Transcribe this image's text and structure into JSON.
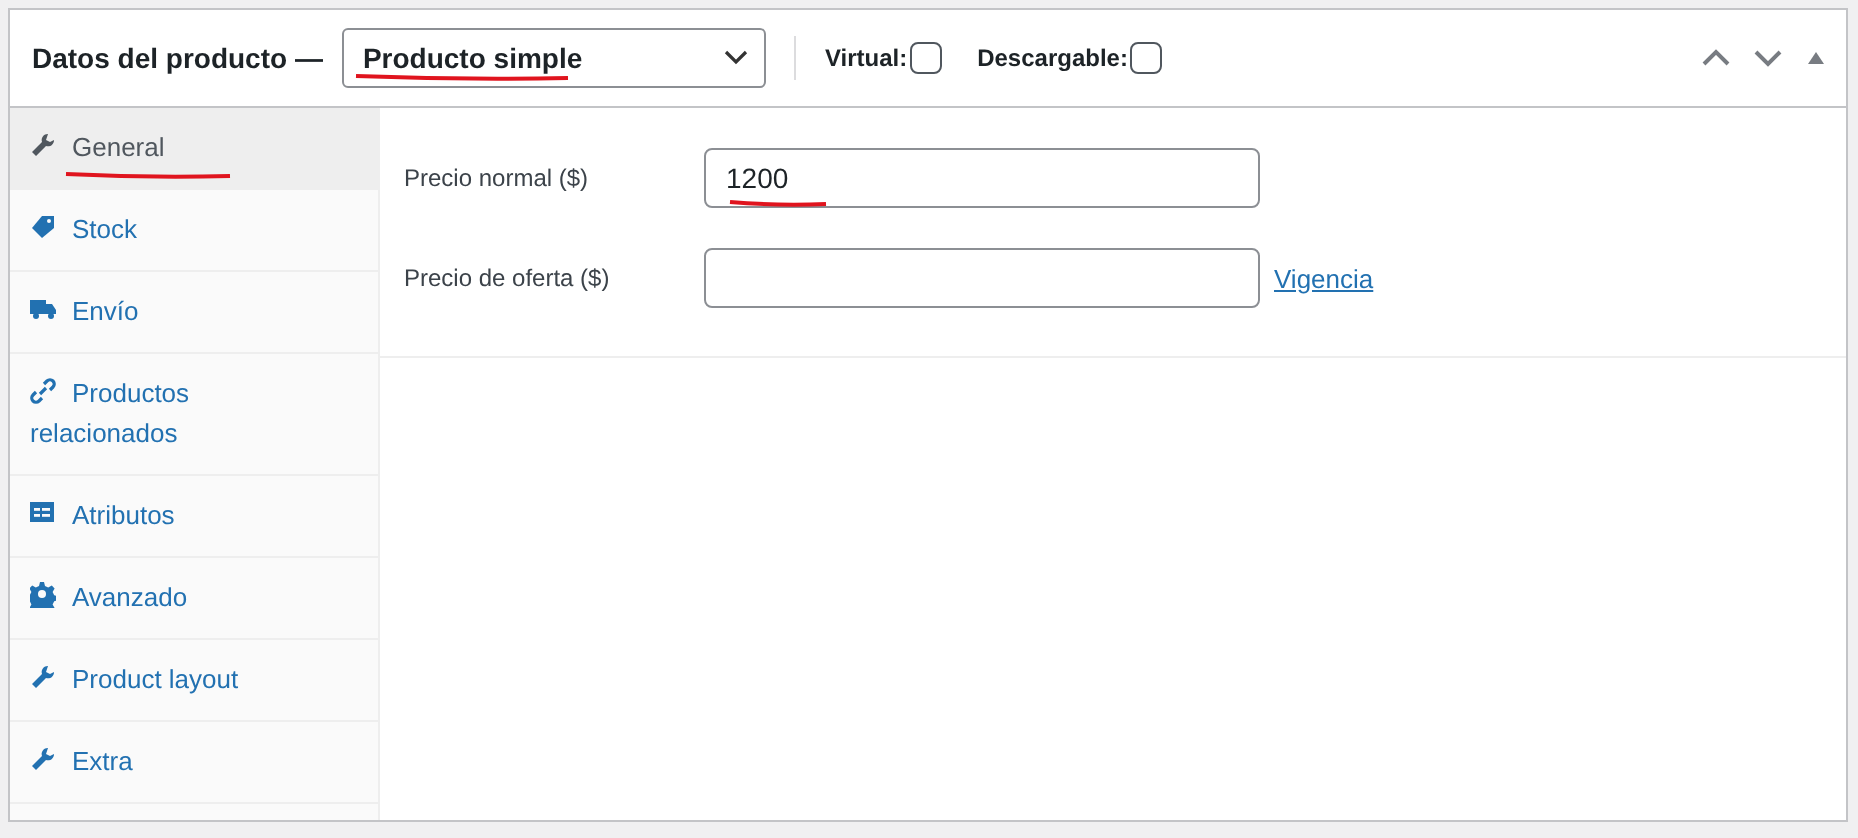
{
  "header": {
    "title": "Datos del producto —",
    "product_type": {
      "value": "Producto simple",
      "underlined": true
    },
    "options": [
      {
        "label": "Virtual:",
        "checked": false
      },
      {
        "label": "Descargable:",
        "checked": false
      }
    ]
  },
  "tabs": [
    {
      "label": "General",
      "kind": "wrench",
      "selected": true,
      "underlined": true
    },
    {
      "label": "Stock",
      "kind": "tag",
      "selected": false,
      "underlined": false
    },
    {
      "label": "Envío",
      "kind": "truck",
      "selected": false,
      "underlined": false
    },
    {
      "label": "Productos relacionados",
      "kind": "link",
      "selected": false,
      "underlined": false
    },
    {
      "label": "Atributos",
      "kind": "list",
      "selected": false,
      "underlined": false
    },
    {
      "label": "Avanzado",
      "kind": "gear",
      "selected": false,
      "underlined": false
    },
    {
      "label": "Product layout",
      "kind": "wrench",
      "selected": false,
      "underlined": false
    },
    {
      "label": "Extra",
      "kind": "wrench",
      "selected": false,
      "underlined": false
    }
  ],
  "fields": [
    {
      "label": "Precio normal ($)",
      "value": "1200",
      "underlined": true
    },
    {
      "label": "Precio de oferta ($)",
      "link": "Vigencia",
      "underlined": false
    }
  ]
}
